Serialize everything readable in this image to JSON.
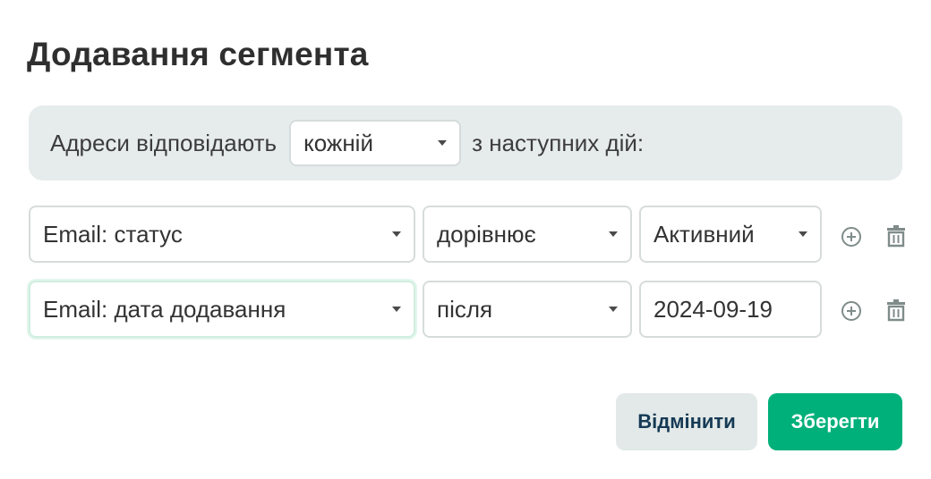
{
  "dialog": {
    "title": "Додавання сегмента"
  },
  "match": {
    "prefix": "Адреси відповідають",
    "mode": "кожній",
    "suffix": "з наступних дій:"
  },
  "conditions": [
    {
      "field": "Email: статус",
      "operator": "дорівнює",
      "value": "Активний",
      "value_type": "select"
    },
    {
      "field": "Email: дата додавання",
      "operator": "після",
      "value": "2024-09-19",
      "value_type": "input"
    }
  ],
  "actions": {
    "cancel_label": "Відмінити",
    "save_label": "Зберегти"
  },
  "colors": {
    "primary": "#00b07a",
    "secondary_bg": "#e2e9e8",
    "secondary_text": "#163a55",
    "panel_bg": "#e6eceb"
  },
  "icons": {
    "add": "plus-circle-icon",
    "delete": "trash-icon"
  }
}
